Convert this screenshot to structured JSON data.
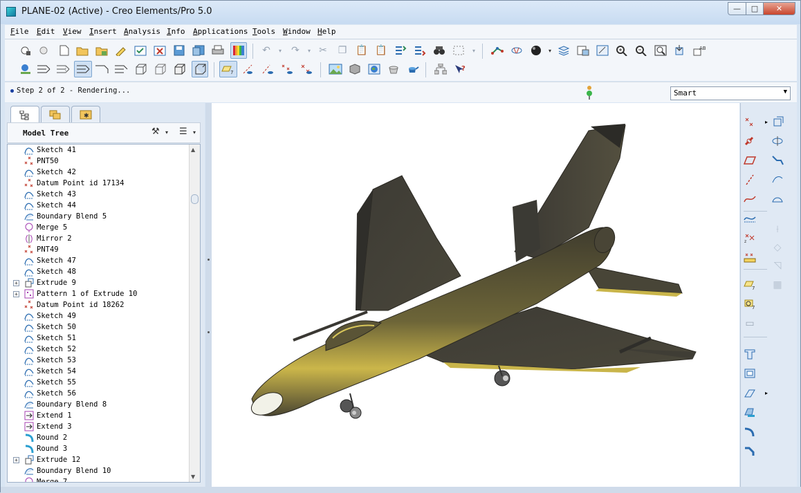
{
  "window": {
    "title": "PLANE-02 (Active) - Creo Elements/Pro 5.0",
    "buttons": {
      "minimize": "—",
      "maximize": "□",
      "close": "✕"
    }
  },
  "menu": [
    {
      "label": "File",
      "underline": "F",
      "rest": "ile"
    },
    {
      "label": "Edit",
      "underline": "E",
      "rest": "dit"
    },
    {
      "label": "View",
      "underline": "V",
      "rest": "iew"
    },
    {
      "label": "Insert",
      "underline": "I",
      "rest": "nsert"
    },
    {
      "label": "Analysis",
      "underline": "A",
      "rest": "nalysis"
    },
    {
      "label": "Info",
      "underline": "I",
      "rest": "nfo"
    },
    {
      "label": "Applications",
      "underline": "A",
      "rest": "pplications"
    },
    {
      "label": "Tools",
      "underline": "T",
      "rest": "ools"
    },
    {
      "label": "Window",
      "underline": "W",
      "rest": "indow"
    },
    {
      "label": "Help",
      "underline": "H",
      "rest": "elp"
    }
  ],
  "status": {
    "message": "Step 2 of 2 - Rendering...",
    "filter_value": "Smart",
    "indicator_color": "#3bb54a"
  },
  "left_panel": {
    "tabs": [
      "model-tree-icon",
      "layers-icon",
      "favorites-icon"
    ],
    "tree_title": "Model Tree",
    "tree_items": [
      {
        "label": "Sketch 41",
        "icon": "sketch",
        "expandable": false
      },
      {
        "label": "PNT50",
        "icon": "point",
        "expandable": false
      },
      {
        "label": "Sketch 42",
        "icon": "sketch",
        "expandable": false
      },
      {
        "label": "Datum Point id 17134",
        "icon": "point",
        "expandable": false
      },
      {
        "label": "Sketch 43",
        "icon": "sketch",
        "expandable": false
      },
      {
        "label": "Sketch 44",
        "icon": "sketch",
        "expandable": false
      },
      {
        "label": "Boundary Blend 5",
        "icon": "blend",
        "expandable": false
      },
      {
        "label": "Merge 5",
        "icon": "merge",
        "expandable": false
      },
      {
        "label": "Mirror 2",
        "icon": "mirror",
        "expandable": false
      },
      {
        "label": "PNT49",
        "icon": "point",
        "expandable": false
      },
      {
        "label": "Sketch 47",
        "icon": "sketch",
        "expandable": false
      },
      {
        "label": "Sketch 48",
        "icon": "sketch",
        "expandable": false
      },
      {
        "label": "Extrude 9",
        "icon": "extrude",
        "expandable": true
      },
      {
        "label": "Pattern 1 of Extrude 10",
        "icon": "pattern",
        "expandable": true
      },
      {
        "label": "Datum Point id 18262",
        "icon": "point",
        "expandable": false
      },
      {
        "label": "Sketch 49",
        "icon": "sketch",
        "expandable": false
      },
      {
        "label": "Sketch 50",
        "icon": "sketch",
        "expandable": false
      },
      {
        "label": "Sketch 51",
        "icon": "sketch",
        "expandable": false
      },
      {
        "label": "Sketch 52",
        "icon": "sketch",
        "expandable": false
      },
      {
        "label": "Sketch 53",
        "icon": "sketch",
        "expandable": false
      },
      {
        "label": "Sketch 54",
        "icon": "sketch",
        "expandable": false
      },
      {
        "label": "Sketch 55",
        "icon": "sketch",
        "expandable": false
      },
      {
        "label": "Sketch 56",
        "icon": "sketch",
        "expandable": false
      },
      {
        "label": "Boundary Blend 8",
        "icon": "blend",
        "expandable": false
      },
      {
        "label": "Extend 1",
        "icon": "extend",
        "expandable": false
      },
      {
        "label": "Extend 3",
        "icon": "extend",
        "expandable": false
      },
      {
        "label": "Round 2",
        "icon": "round",
        "expandable": false
      },
      {
        "label": "Round 3",
        "icon": "round",
        "expandable": false
      },
      {
        "label": "Extrude 12",
        "icon": "extrude",
        "expandable": true
      },
      {
        "label": "Boundary Blend 10",
        "icon": "blend",
        "expandable": false
      },
      {
        "label": "Merge 7",
        "icon": "merge",
        "expandable": false
      }
    ]
  },
  "colors": {
    "model_body": "#4a4736",
    "model_highlight": "#d9c44a",
    "accent": "#3a7fd0"
  }
}
